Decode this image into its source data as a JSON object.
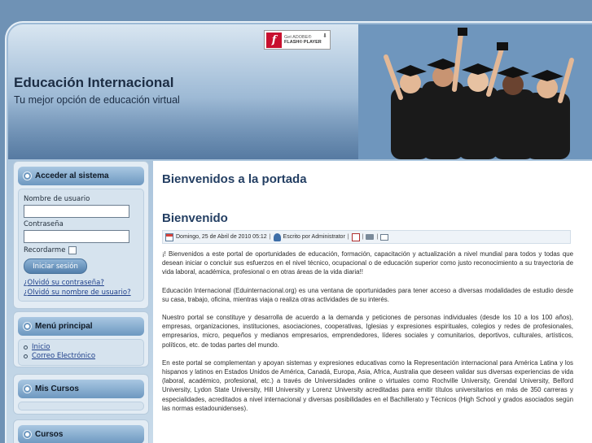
{
  "site": {
    "title": "Educación Internacional",
    "slogan": "Tu mejor opción de educación virtual"
  },
  "flash_badge": {
    "line1": "Get ADOBE®",
    "line2": "FLASH® PLAYER",
    "logo_glyph": "f"
  },
  "login_module": {
    "title": "Acceder al sistema",
    "username_label": "Nombre de usuario",
    "username_value": "",
    "password_label": "Contraseña",
    "password_value": "",
    "remember_label": "Recordarme",
    "submit_label": "Iniciar sesión",
    "forgot_password": "¿Olvidó su contraseña?",
    "forgot_username": "¿Olvidó su nombre de usuario?"
  },
  "main_menu": {
    "title": "Menú principal",
    "items": [
      "Inicio",
      "Correo Electrónico"
    ]
  },
  "courses_module": {
    "title": "Mis Cursos"
  },
  "cursos_module": {
    "title": "Cursos"
  },
  "content": {
    "page_heading": "Bienvenidos a la portada",
    "article_title": "Bienvenido",
    "meta": {
      "date": "Domingo, 25 de Abril de 2010 05:12",
      "author": "Escrito por Administrator",
      "separator": "|"
    },
    "paragraphs": [
      "¡! Bienvenidos a este portal de oportunidades de educación, formación, capacitación y actualización a nivel mundial para todos y todas que desean iniciar o concluir sus esfuerzos en el nivel técnico, ocupacional o de educación superior como justo reconocimiento a su trayectoria de vida laboral, académica, profesional o en otras áreas de la vida diaria!!",
      "Educación Internacional (Eduinternacional.org) es una ventana de oportunidades para tener acceso a diversas modalidades de estudio desde su casa, trabajo, oficina, mientras viaja o realiza otras actividades de su interés.",
      "Nuestro portal se constituye y desarrolla de acuerdo a la demanda y peticiones de personas individuales (desde los 10 a los 100 años), empresas, organizaciones, instituciones, asociaciones, cooperativas, Iglesias y expresiones espirituales, colegios y redes de profesionales, empresarios, micro, pequeños y medianos empresarios, emprendedores, líderes sociales y comunitarios, deportivos, culturales, artísticos, políticos, etc. de todas partes del mundo.",
      "En este portal se complementan y apoyan sistemas y expresiones educativas como la Representación internacional para América Latina y los hispanos y latinos en Estados Unidos de América, Canadá, Europa, Asia, Africa, Australia que deseen validar sus diversas experiencias de vida (laboral, académico, profesional, etc.) a través de Universidades online o virtuales como Rochville University, Grendal University, Belford University, Lydon State University, Hill University y Lorenz University acreditadas para emitir títulos universitarios en más de 350 carreras y especialidades, acreditados a nivel internacional y diversas posibilidades en el Bachillerato y Técnicos (High School y grados asociados según las normas estadounidenses)."
    ]
  },
  "colors": {
    "heading": "#243f63",
    "link": "#1e3f8a",
    "module_head": "#6d98c0",
    "page_bg": "#6f92b5"
  }
}
